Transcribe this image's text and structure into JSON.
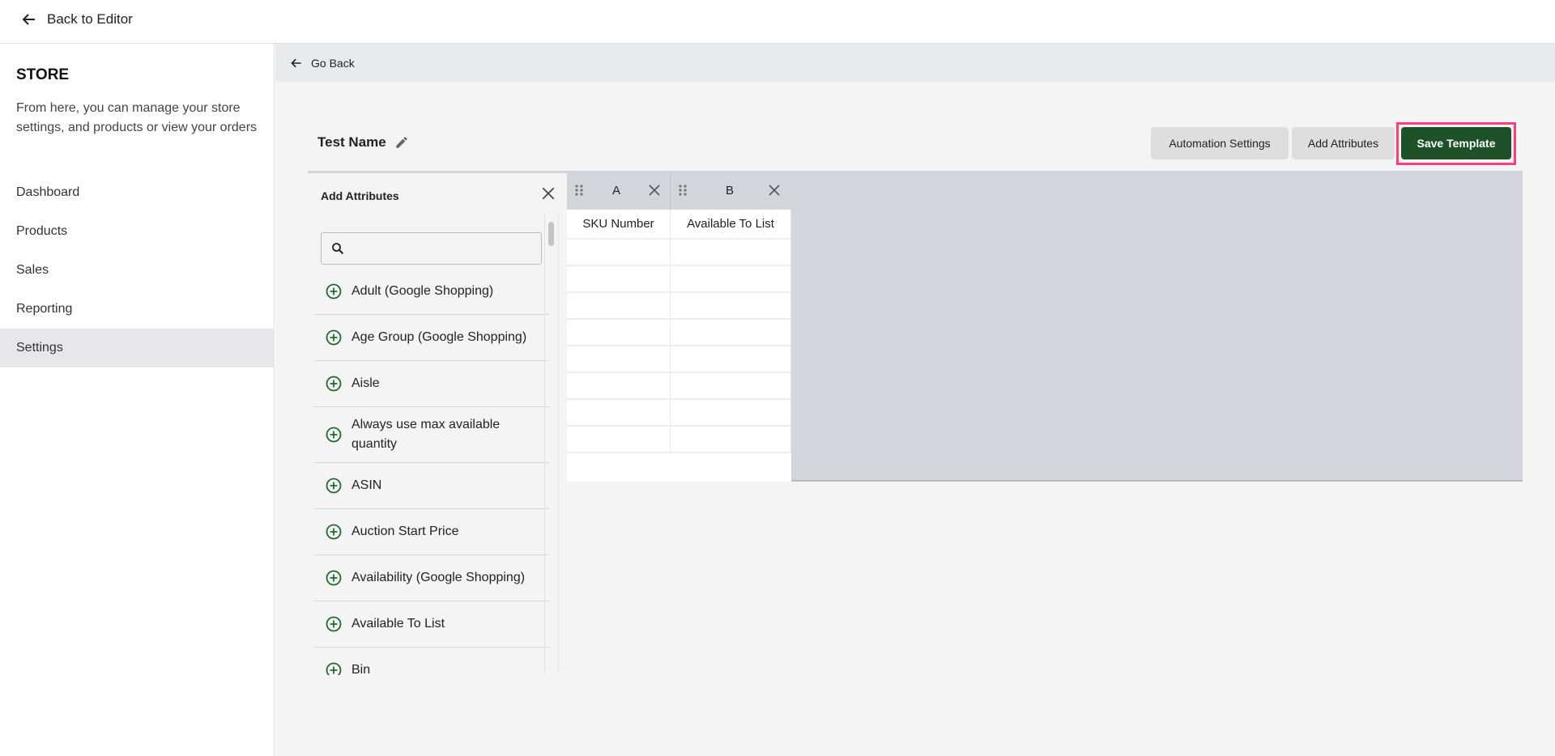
{
  "topbar": {
    "back_label": "Back to Editor"
  },
  "sidebar": {
    "title": "STORE",
    "description": "From here, you can manage your store settings, and products or view your orders",
    "items": [
      {
        "label": "Dashboard"
      },
      {
        "label": "Products"
      },
      {
        "label": "Sales"
      },
      {
        "label": "Reporting"
      },
      {
        "label": "Settings",
        "selected": true
      }
    ]
  },
  "main": {
    "go_back": "Go Back",
    "template_name": "Test Name",
    "buttons": {
      "automation": "Automation Settings",
      "add_attributes": "Add Attributes",
      "save": "Save Template"
    },
    "colors": {
      "save_bg": "#1e5128",
      "highlight": "#ff3d7f",
      "plus_icon": "#1e6b2e"
    }
  },
  "attributes_panel": {
    "title": "Add Attributes",
    "search_placeholder": "",
    "items": [
      "Adult (Google Shopping)",
      "Age Group (Google Shopping)",
      "Aisle",
      "Always use max available quantity",
      "ASIN",
      "Auction Start Price",
      "Availability (Google Shopping)",
      "Available To List",
      "Bin"
    ]
  },
  "grid": {
    "columns": [
      {
        "letter": "A",
        "header": "SKU Number"
      },
      {
        "letter": "B",
        "header": "Available To List"
      }
    ]
  }
}
